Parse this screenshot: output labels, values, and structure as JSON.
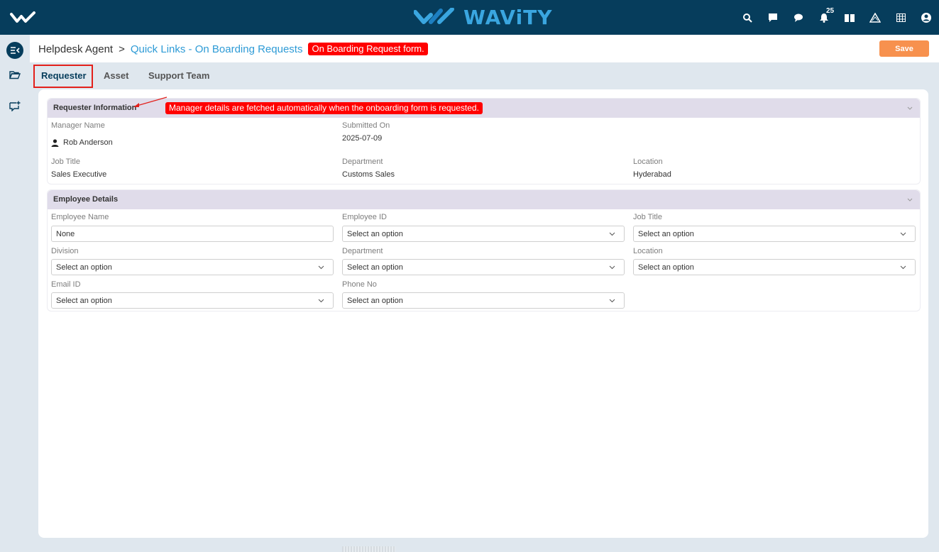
{
  "topbar": {
    "brand": "WAViTY",
    "notification_count": "25"
  },
  "header": {
    "breadcrumb_root": "Helpdesk Agent",
    "breadcrumb_sep": ">",
    "breadcrumb_link": "Quick Links - On Boarding Requests",
    "annotation": "On Boarding Request form.",
    "save_label": "Save"
  },
  "tabs": [
    "Requester",
    "Asset",
    "Support Team"
  ],
  "requester_section": {
    "title": "Requester Information",
    "annotation": "Manager details are fetched automatically when the onboarding form is requested.",
    "manager_name_label": "Manager Name",
    "manager_name": "Rob Anderson",
    "submitted_on_label": "Submitted On",
    "submitted_on": "2025-07-09",
    "job_title_label": "Job Title",
    "job_title": "Sales Executive",
    "department_label": "Department",
    "department": "Customs Sales",
    "location_label": "Location",
    "location": "Hyderabad"
  },
  "employee_section": {
    "title": "Employee Details",
    "employee_name_label": "Employee Name",
    "employee_name": "None",
    "employee_id_label": "Employee ID",
    "job_title_label": "Job Title",
    "division_label": "Division",
    "department_label": "Department",
    "location_label": "Location",
    "email_label": "Email ID",
    "phone_label": "Phone No",
    "select_placeholder": "Select an option"
  },
  "colors": {
    "topbar": "#063d5c",
    "accent": "#2e9bd6",
    "save": "#f7914e",
    "annotation": "#ff0000"
  }
}
